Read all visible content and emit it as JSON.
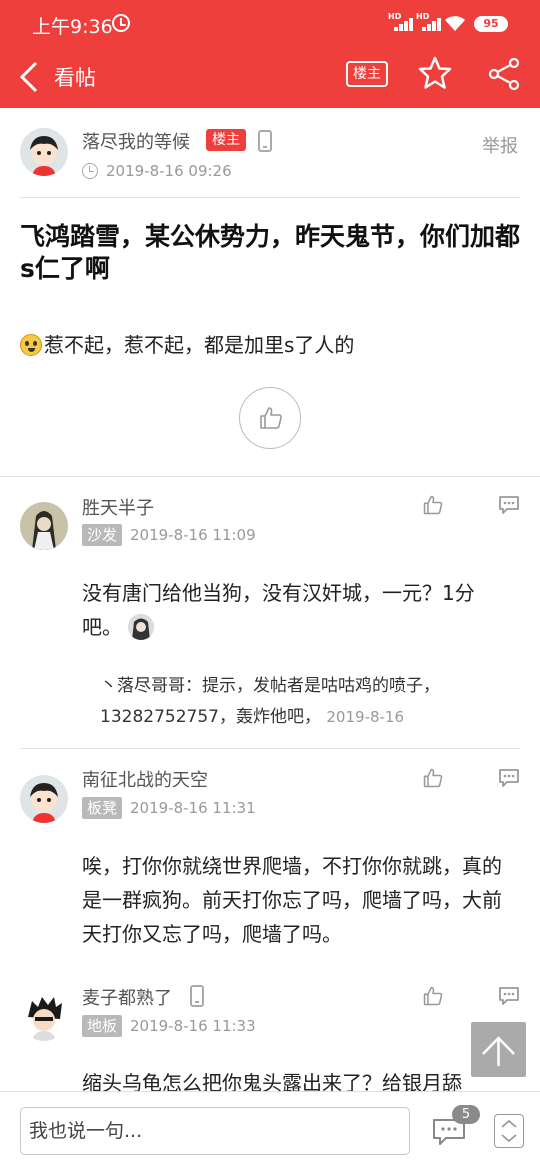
{
  "status": {
    "time": "上午9:36",
    "hd1": "HD",
    "hd2": "HD",
    "battery": "95"
  },
  "appbar": {
    "title": "看帖",
    "owner_only_label": "楼主"
  },
  "post": {
    "author": "落尽我的等候",
    "author_tag": "楼主",
    "report": "举报",
    "time": "2019-8-16 09:26",
    "title": "飞鸿踏雪，某公休势力，昨天鬼节，你们加都s仁了啊",
    "body": "惹不起，惹不起，都是加里s了人的"
  },
  "comments": [
    {
      "name": "胜天半子",
      "floor": "沙发",
      "time": "2019-8-16 11:09",
      "text": "没有唐门给他当狗，没有汉奸城，一元？1分吧。",
      "reply": {
        "text": "丶落尽哥哥：提示，发帖者是咕咕鸡的喷子，13282752757，轰炸他吧，",
        "time": "2019-8-16"
      }
    },
    {
      "name": "南征北战的天空",
      "floor": "板凳",
      "time": "2019-8-16 11:31",
      "text": "唉，打你你就绕世界爬墙，不打你你就跳，真的是一群疯狗。前天打你忘了吗，爬墙了吗，大前天打你又忘了吗，爬墙了吗。"
    },
    {
      "name": "麦子都熟了",
      "floor": "地板",
      "time": "2019-8-16 11:33",
      "text": "缩头乌龟怎么把你鬼头露出来了？给银月舔"
    }
  ],
  "bottom": {
    "placeholder": "我也说一句...",
    "comment_count": "5"
  },
  "colors": {
    "brand": "#ee3f3d",
    "tag_gray": "#b9b9b9"
  }
}
